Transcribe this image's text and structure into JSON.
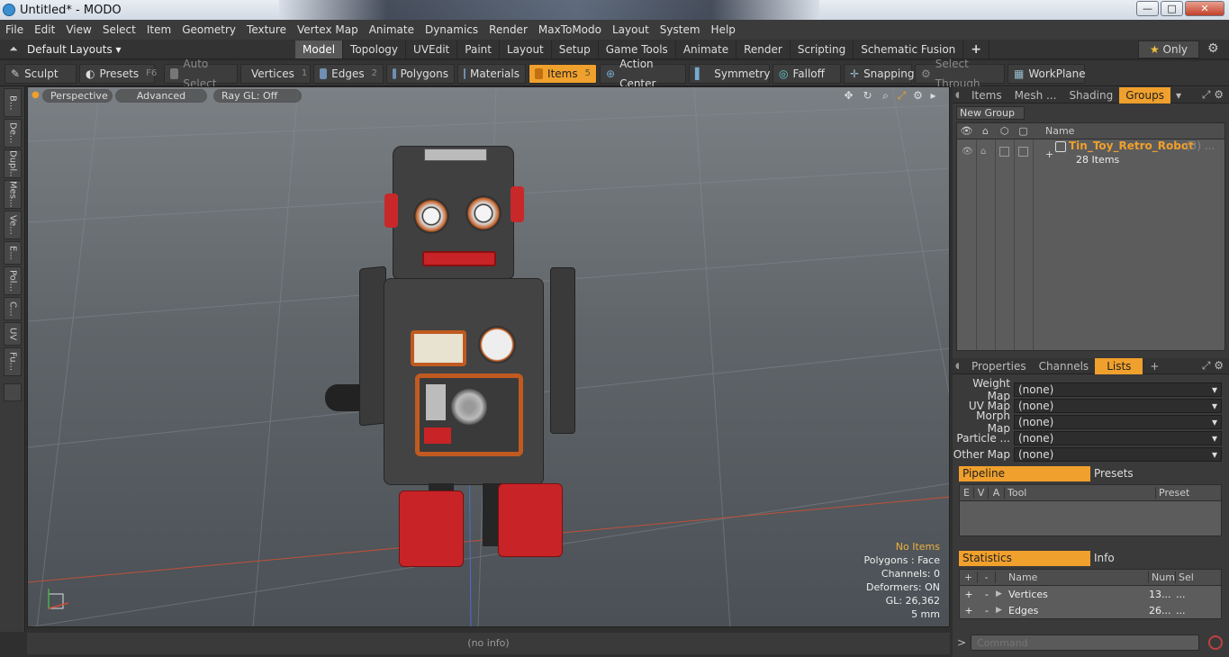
{
  "window": {
    "title": "Untitled* - MODO",
    "min": "—",
    "max": "□",
    "close": "✕"
  },
  "menu": [
    "File",
    "Edit",
    "View",
    "Select",
    "Item",
    "Geometry",
    "Texture",
    "Vertex Map",
    "Animate",
    "Dynamics",
    "Render",
    "MaxToModo",
    "Layout",
    "System",
    "Help"
  ],
  "layout_bar": {
    "layout_dropdown": "Default Layouts",
    "tabs": [
      "Model",
      "Topology",
      "UVEdit",
      "Paint",
      "Layout",
      "Setup",
      "Game Tools",
      "Animate",
      "Render",
      "Scripting",
      "Schematic Fusion"
    ],
    "active_tab": "Model",
    "add": "+",
    "only_label": "Only",
    "star": "★"
  },
  "toolbar": {
    "sculpt": "Sculpt",
    "presets": "Presets",
    "presets_key": "F6",
    "auto_select": "Auto Select",
    "vertices": "Vertices",
    "vertices_num": "1",
    "edges": "Edges",
    "edges_num": "2",
    "polygons": "Polygons",
    "materials": "Materials",
    "items": "Items",
    "items_num": "5",
    "action_center": "Action Center",
    "symmetry": "Symmetry",
    "falloff": "Falloff",
    "snapping": "Snapping",
    "select_through": "Select Through",
    "workplane": "WorkPlane"
  },
  "left_tabs": [
    "B...",
    "De...",
    "Dupl...",
    "Mes...",
    "Ve...",
    "E...",
    "Pol...",
    "C...",
    "UV",
    "Fu..."
  ],
  "viewport": {
    "perspective": "Perspective",
    "advanced": "Advanced",
    "raygl": "Ray GL: Off",
    "stats": {
      "no_items": "No Items",
      "polygons": "Polygons : Face",
      "channels": "Channels: 0",
      "deformers": "Deformers: ON",
      "gl": "GL: 26,362",
      "unit": "5 mm"
    }
  },
  "info_bar": "(no info)",
  "right_top": {
    "tabs": [
      "Items",
      "Mesh ...",
      "Shading",
      "Groups"
    ],
    "active_tab": "Groups",
    "new_group": "New Group",
    "col_name": "Name",
    "group_name": "Tin_Toy_Retro_Robot",
    "group_count": "(3) ...",
    "group_items": "28 Items"
  },
  "right_mid": {
    "tabs": [
      "Properties",
      "Channels",
      "Lists"
    ],
    "active_tab": "Lists",
    "maps": [
      {
        "label": "Weight Map",
        "value": "(none)"
      },
      {
        "label": "UV Map",
        "value": "(none)"
      },
      {
        "label": "Morph Map",
        "value": "(none)"
      },
      {
        "label": "Particle ...",
        "value": "(none)"
      },
      {
        "label": "Other Map",
        "value": "(none)"
      }
    ],
    "pipeline": "Pipeline",
    "presets": "Presets",
    "pipe_cols": [
      "E",
      "V",
      "A",
      "Tool",
      "Preset"
    ]
  },
  "right_bottom": {
    "statistics": "Statistics",
    "info": "Info",
    "cols": [
      "+",
      "-",
      "Name",
      "Num",
      "Sel"
    ],
    "rows": [
      {
        "plus": "+",
        "minus": "-",
        "name": "Vertices",
        "num": "13...",
        "sel": "..."
      },
      {
        "plus": "+",
        "minus": "-",
        "name": "Edges",
        "num": "26...",
        "sel": "..."
      }
    ]
  },
  "command": {
    "prompt": ">",
    "placeholder": "Command"
  }
}
